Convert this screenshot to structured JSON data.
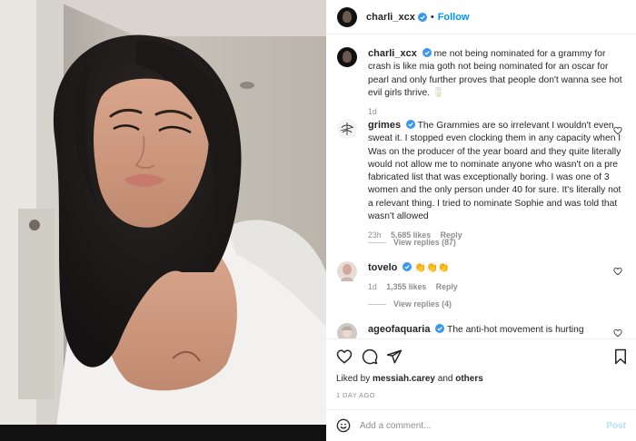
{
  "header": {
    "username": "charli_xcx",
    "separator": "•",
    "follow_label": "Follow"
  },
  "caption": {
    "username": "charli_xcx",
    "text": "me not being nominated for a grammy for crash is like mia goth not being nominated for an oscar for pearl and only further proves that people don't wanna see hot evil girls thrive. 🥛",
    "age": "1d"
  },
  "comments": [
    {
      "username": "grimes",
      "text": "The Grammies are so irrelevant I wouldn't even sweat it. I stopped even clocking them in any capacity when I Was on the producer of the year board and they quite literally would not allow me to nominate anyone who wasn't on a pre fabricated list that was exceptionally boring. I was one of 3 women and the only person under 40 for sure. It's literally not a relevant thing. I tried to nominate Sophie and was told that wasn't allowed",
      "age": "23h",
      "likes": "5,685 likes",
      "reply": "Reply",
      "view_replies": "View replies (87)"
    },
    {
      "username": "tovelo",
      "text": "👏👏👏",
      "age": "1d",
      "likes": "1,355 likes",
      "reply": "Reply",
      "view_replies": "View replies (4)"
    },
    {
      "username": "ageofaquaria",
      "text": "The anti-hot movement is hurting"
    }
  ],
  "likes_line": {
    "prefix": "Liked by",
    "user": "messiah.carey",
    "joiner": "and",
    "others": "others"
  },
  "timestamp": "1 DAY AGO",
  "add_comment": {
    "placeholder": "Add a comment...",
    "post_label": "Post"
  },
  "colors": {
    "accent": "#0095f6",
    "verified": "#3897f0",
    "muted": "#8e8e8e"
  }
}
